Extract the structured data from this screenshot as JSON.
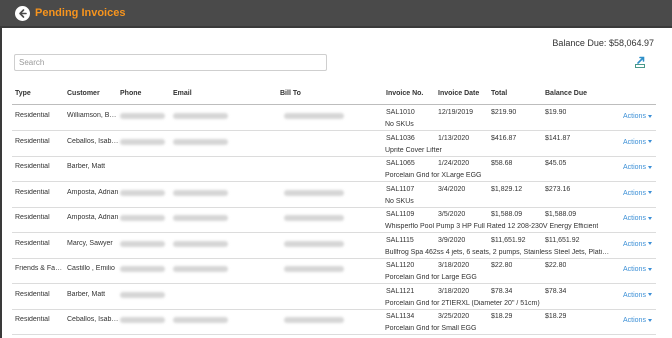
{
  "header": {
    "title": "Pending Invoices"
  },
  "balance": {
    "label": "Balance Due:",
    "amount": "$58,064.97"
  },
  "search": {
    "placeholder": "Search"
  },
  "icons": {
    "back": "back-arrow-icon",
    "export": "export-icon"
  },
  "colors": {
    "accent": "#f7941d",
    "topbar": "#4a4a4a",
    "link": "#3b8fd6"
  },
  "table": {
    "columns": [
      "Type",
      "Customer",
      "Phone",
      "Email",
      "Bill To",
      "Invoice No.",
      "Invoice Date",
      "Total",
      "Balance Due"
    ],
    "action_label": "Actions",
    "rows": [
      {
        "type": "Residential",
        "customer": "Williamson, Bar...",
        "invoice_no": "SAL1010",
        "desc": "No SKUs",
        "date": "12/19/2019",
        "total": "$219.90",
        "balance": "$19.90",
        "has_phone": true,
        "has_email": true,
        "has_billto": true
      },
      {
        "type": "Residential",
        "customer": "Ceballos, Isabe...",
        "invoice_no": "SAL1036",
        "desc": "Uprite Cover Lifter",
        "date": "1/13/2020",
        "total": "$416.87",
        "balance": "$141.87",
        "has_phone": true,
        "has_email": true,
        "has_billto": false
      },
      {
        "type": "Residential",
        "customer": "Barber, Matt",
        "invoice_no": "SAL1065",
        "desc": "Porcelain Grid for XLarge EGG",
        "date": "1/24/2020",
        "total": "$58.68",
        "balance": "$45.05",
        "has_phone": false,
        "has_email": false,
        "has_billto": false
      },
      {
        "type": "Residential",
        "customer": "Amposta, Adrian",
        "invoice_no": "SAL1107",
        "desc": "No SKUs",
        "date": "3/4/2020",
        "total": "$1,829.12",
        "balance": "$273.16",
        "has_phone": true,
        "has_email": true,
        "has_billto": true
      },
      {
        "type": "Residential",
        "customer": "Amposta, Adrian",
        "invoice_no": "SAL1109",
        "desc": "Whisperflo Pool Pump 3 HP Full Rated 12 208-230V Energy Efficient",
        "date": "3/5/2020",
        "total": "$1,588.09",
        "balance": "$1,588.09",
        "has_phone": true,
        "has_email": true,
        "has_billto": true
      },
      {
        "type": "Residential",
        "customer": "Marcy, Sawyer",
        "invoice_no": "SAL1115",
        "desc": "Bullfrog Spa 462ss 4 jets, 6 seats, 2 pumps, Stainless Steel Jets, Platin...",
        "date": "3/9/2020",
        "total": "$11,651.92",
        "balance": "$11,651.92",
        "has_phone": true,
        "has_email": true,
        "has_billto": true
      },
      {
        "type": "Friends & Famil...",
        "customer": "Castillo , Emilio",
        "invoice_no": "SAL1120",
        "desc": "Porcelain Grid for Large EGG",
        "date": "3/18/2020",
        "total": "$22.80",
        "balance": "$22.80",
        "has_phone": true,
        "has_email": true,
        "has_billto": true
      },
      {
        "type": "Residential",
        "customer": "Barber, Matt",
        "invoice_no": "SAL1121",
        "desc": "Porcelain Grid for 2TIERXL (Diameter 20\" / 51cm)",
        "date": "3/18/2020",
        "total": "$78.34",
        "balance": "$78.34",
        "has_phone": true,
        "has_email": false,
        "has_billto": false
      },
      {
        "type": "Residential",
        "customer": "Ceballos, Isabe...",
        "invoice_no": "SAL1134",
        "desc": "Porcelain Grid for Small EGG",
        "date": "3/25/2020",
        "total": "$18.29",
        "balance": "$18.29",
        "has_phone": true,
        "has_email": true,
        "has_billto": true
      }
    ]
  }
}
